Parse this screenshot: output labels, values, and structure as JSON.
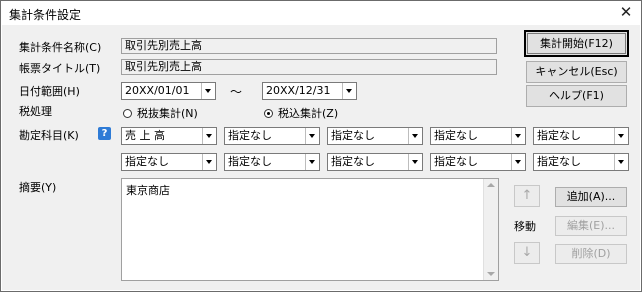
{
  "window": {
    "title": "集計条件設定",
    "close": "✕"
  },
  "form": {
    "name_label": "集計条件名称(C)",
    "name_value": "取引先別売上高",
    "report_title_label": "帳票タイトル(T)",
    "report_title_value": "取引先別売上高",
    "date_label": "日付範囲(H)",
    "date_from": "20XX/01/01",
    "date_tilde": "～",
    "date_to": "20XX/12/31",
    "tax_label": "税処理",
    "tax_options": [
      {
        "label": "税抜集計(N)",
        "checked": false
      },
      {
        "label": "税込集計(Z)",
        "checked": true
      }
    ],
    "account_label": "勘定科目(K)",
    "help_icon_text": "?",
    "account_row1": [
      "売 上 高",
      "指定なし",
      "指定なし",
      "指定なし",
      "指定なし"
    ],
    "account_row2": [
      "指定なし",
      "指定なし",
      "指定なし",
      "指定なし",
      "指定なし"
    ],
    "memo_label": "摘要(Y)",
    "memo_items": [
      "東京商店"
    ]
  },
  "buttons": {
    "start": "集計開始(F12)",
    "cancel": "キャンセル(Esc)",
    "help": "ヘルプ(F1)",
    "add": "追加(A)...",
    "edit": "編集(E)...",
    "delete": "削除(D)",
    "move_label": "移動",
    "up": "↑",
    "down": "↓"
  }
}
